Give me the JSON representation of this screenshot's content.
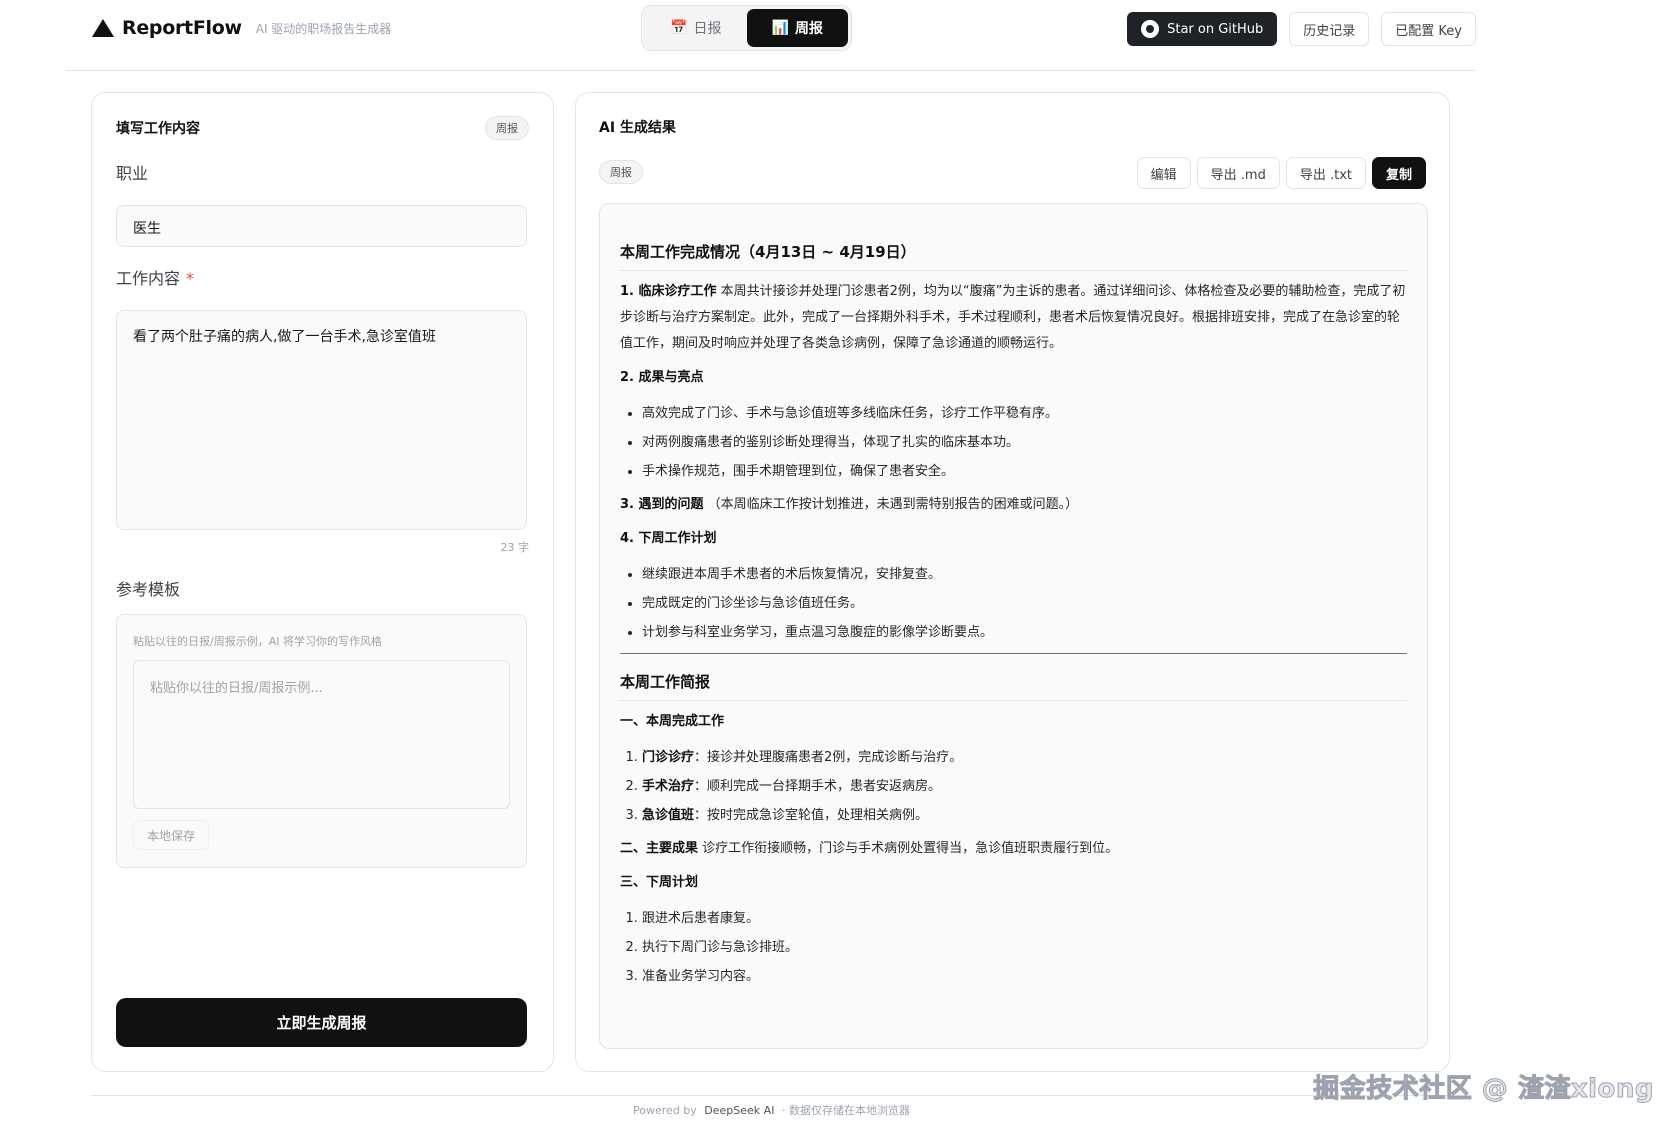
{
  "header": {
    "brand_name": "ReportFlow",
    "brand_sub": "AI 驱动的职场报告生成器",
    "tabs": [
      {
        "icon": "📅",
        "label": "日报",
        "active": false
      },
      {
        "icon": "📊",
        "label": "周报",
        "active": true
      }
    ],
    "github_label": "Star on GitHub",
    "history_label": "历史记录",
    "key_label": "已配置 Key"
  },
  "left": {
    "title": "填写工作内容",
    "mode_pill": "周报",
    "job_label": "职业",
    "job_value": "医生",
    "content_label": "工作内容",
    "required_mark": "*",
    "content_value": "看了两个肚子痛的病人,做了一台手术,急诊室值班",
    "char_count": "23 字",
    "template_label": "参考模板",
    "template_hint": "粘贴以往的日报/周报示例，AI 将学习你的写作风格",
    "template_placeholder": "粘贴你以往的日报/周报示例...",
    "save_label": "本地保存",
    "generate_label": "立即生成周报"
  },
  "right": {
    "title": "AI 生成结果",
    "mode_pill": "周报",
    "actions": {
      "edit": "编辑",
      "export_md": "导出 .md",
      "export_txt": "导出 .txt",
      "copy": "复制"
    },
    "report": {
      "h1": "本周工作完成情况（4月13日 ~ 4月19日）",
      "s1_title": "1. 临床诊疗工作",
      "s1_text": " 本周共计接诊并处理门诊患者2例，均为以“腹痛”为主诉的患者。通过详细问诊、体格检查及必要的辅助检查，完成了初步诊断与治疗方案制定。此外，完成了一台择期外科手术，手术过程顺利，患者术后恢复情况良好。根据排班安排，完成了在急诊室的轮值工作，期间及时响应并处理了各类急诊病例，保障了急诊通道的顺畅运行。",
      "s2_title": "2. 成果与亮点",
      "s2_items": [
        "高效完成了门诊、手术与急诊值班等多线临床任务，诊疗工作平稳有序。",
        "对两例腹痛患者的鉴别诊断处理得当，体现了扎实的临床基本功。",
        "手术操作规范，围手术期管理到位，确保了患者安全。"
      ],
      "s3_title": "3. 遇到的问题",
      "s3_text": " （本周临床工作按计划推进，未遇到需特别报告的困难或问题。）",
      "s4_title": "4. 下周工作计划",
      "s4_items": [
        "继续跟进本周手术患者的术后恢复情况，安排复查。",
        "完成既定的门诊坐诊与急诊值班任务。",
        "计划参与科室业务学习，重点温习急腹症的影像学诊断要点。"
      ],
      "h2": "本周工作简报",
      "b1_title": "一、本周完成工作",
      "b1_items": [
        {
          "bold": "门诊诊疗",
          "text": "：接诊并处理腹痛患者2例，完成诊断与治疗。"
        },
        {
          "bold": "手术治疗",
          "text": "：顺利完成一台择期手术，患者安返病房。"
        },
        {
          "bold": "急诊值班",
          "text": "：按时完成急诊室轮值，处理相关病例。"
        }
      ],
      "b2_title": "二、主要成果",
      "b2_text": " 诊疗工作衔接顺畅，门诊与手术病例处置得当，急诊值班职责履行到位。",
      "b3_title": "三、下周计划",
      "b3_items": [
        "跟进术后患者康复。",
        "执行下周门诊与急诊排班。",
        "准备业务学习内容。"
      ]
    }
  },
  "footer": {
    "powered": "Powered by",
    "provider": "DeepSeek AI",
    "sep": "·",
    "note": "数据仅存储在本地浏览器"
  },
  "watermark": "掘金技术社区 @ 渣渣xiong"
}
